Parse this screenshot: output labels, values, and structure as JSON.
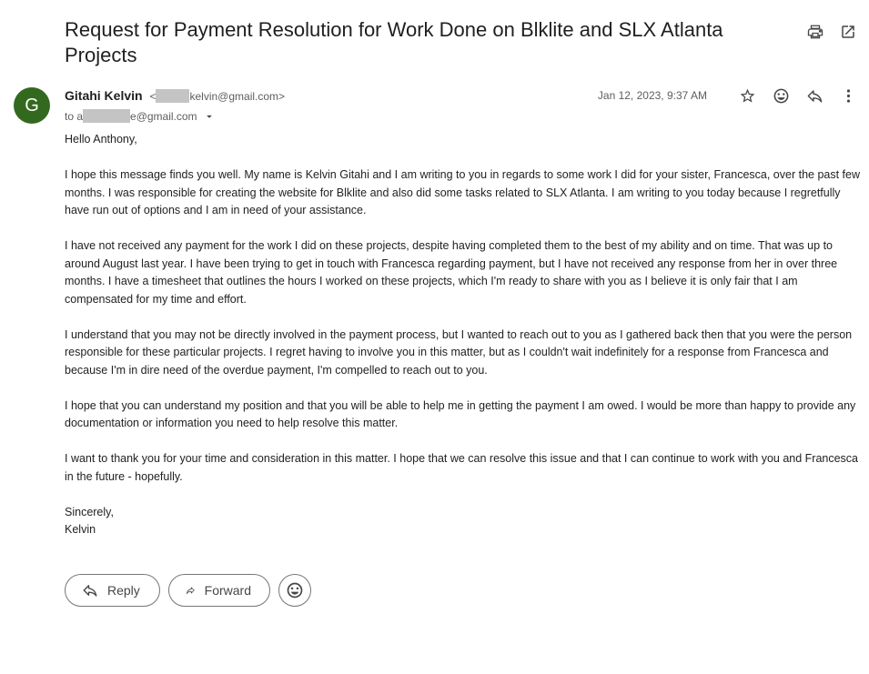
{
  "email": {
    "subject": "Request for Payment Resolution for Work Done on Blklite and SLX Atlanta Projects",
    "sender_initial": "G",
    "sender_name": "Gitahi Kelvin",
    "sender_email_open": "<",
    "sender_email_visible": "kelvin@gmail.com>",
    "to_prefix": "to a",
    "to_visible": "e@gmail.com",
    "date": "Jan 12, 2023, 9:37 AM",
    "greeting": "Hello Anthony,",
    "paragraphs": [
      "I hope this message finds you well. My name is Kelvin Gitahi and I am writing to you in regards to some work I did for your sister, Francesca, over the past few months. I was responsible for creating the website for Blklite and also did some tasks related to SLX Atlanta. I am writing to you today because I regretfully have run out of options and I am in need of your assistance.",
      "I have not received any payment for the work I did on these projects, despite having completed them to the best of my ability and on time. That was up to around August last year. I have been trying to get in touch with Francesca regarding payment, but I have not received any response from her in over three months. I have a timesheet that outlines the hours I worked on these projects, which I'm ready to share with you as I believe it is only fair that I am compensated for my time and effort.",
      "I understand that you may not be directly involved in the payment process, but I wanted to reach out to you as I gathered back then that you were the person responsible for these particular projects. I regret having to involve you in this matter, but as I couldn't wait indefinitely for a response from Francesca and because I'm in dire need of the overdue payment, I'm compelled to reach out to you.",
      "I hope that you can understand my position and that you will be able to help me in getting the payment I am owed. I would be more than happy to provide any documentation or information you need to help resolve this matter.",
      "I want to thank you for your time and consideration in this matter. I hope that we can resolve this issue and that I can continue to work with you and Francesca in the future - hopefully."
    ],
    "closing": "Sincerely,",
    "signature": "Kelvin"
  },
  "actions": {
    "reply_label": "Reply",
    "forward_label": "Forward"
  },
  "icons": {
    "print": "print-icon",
    "open_new_window": "open-in-new-icon",
    "star": "star-icon",
    "emoji": "emoji-icon",
    "reply": "reply-icon",
    "more": "more-vert-icon",
    "forward": "forward-icon"
  },
  "colors": {
    "avatar_bg": "#33691e",
    "icon": "#444746",
    "redaction": "#c4c4c4"
  }
}
